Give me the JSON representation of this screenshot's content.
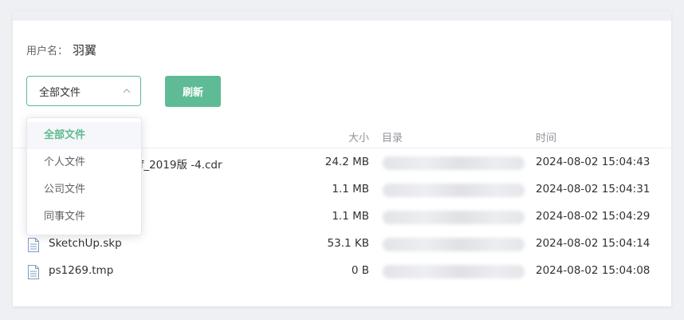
{
  "user": {
    "label": "用户名：",
    "value": "羽翼"
  },
  "filter": {
    "selected": "全部文件",
    "options": [
      "全部文件",
      "个人文件",
      "公司文件",
      "同事文件"
    ],
    "active_color": "#5fb98f"
  },
  "refresh_label": "刷新",
  "table": {
    "headers": {
      "size": "大小",
      "directory": "目录",
      "time": "时间"
    },
    "rows": [
      {
        "name": "p_of_2019版 -4.cdr",
        "size": "24.2 MB",
        "time": "2024-08-02 15:04:43"
      },
      {
        "name": "",
        "size": "1.1 MB",
        "time": "2024-08-02 15:04:31"
      },
      {
        "name": "",
        "size": "1.1 MB",
        "time": "2024-08-02 15:04:29"
      },
      {
        "name": "SketchUp.skp",
        "size": "53.1 KB",
        "time": "2024-08-02 15:04:14"
      },
      {
        "name": "ps1269.tmp",
        "size": "0 B",
        "time": "2024-08-02 15:04:08"
      }
    ]
  },
  "icons": {
    "file": "document-icon",
    "chevron": "chevron-up-icon"
  }
}
